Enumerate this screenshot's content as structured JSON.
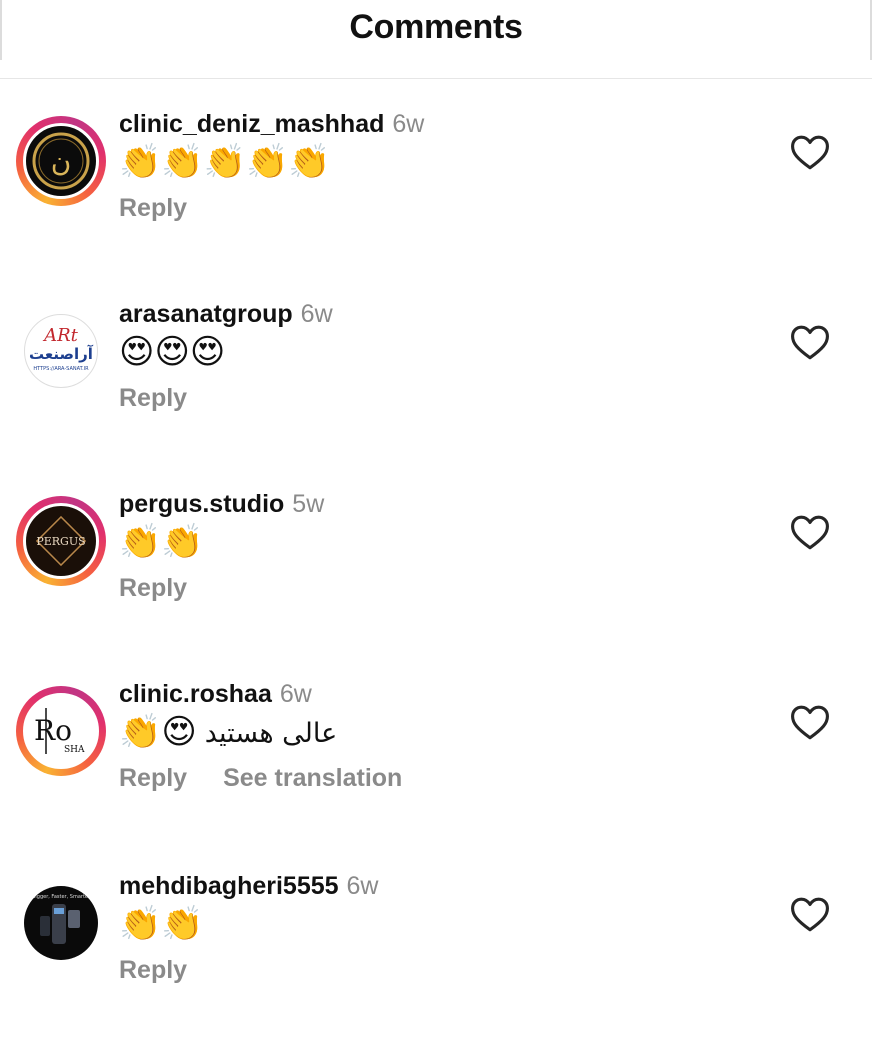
{
  "header": {
    "title": "Comments"
  },
  "comments": [
    {
      "username": "clinic_deniz_mashhad",
      "time": "6w",
      "text": "👏👏👏👏👏",
      "reply": "Reply",
      "translate": ""
    },
    {
      "username": "arasanatgroup",
      "time": "6w",
      "text": "😍😍😍",
      "reply": "Reply",
      "translate": ""
    },
    {
      "username": "pergus.studio",
      "time": "5w",
      "text": "👏👏",
      "reply": "Reply",
      "translate": ""
    },
    {
      "username": "clinic.roshaa",
      "time": "6w",
      "text": "👏😍",
      "text_fa": "عالی هستید",
      "reply": "Reply",
      "translate": "See translation"
    },
    {
      "username": "mehdibagheri5555",
      "time": "6w",
      "text": "👏👏",
      "reply": "Reply",
      "translate": ""
    }
  ],
  "avatars": {
    "a1": "ن",
    "a2_top": "ARt",
    "a2_mid": "آراصنعت",
    "a2_url": "HTTPS://ARA-SANAT.IR",
    "a3": "PERGUS",
    "a4_big": "Ro",
    "a4_small": "SHA",
    "a5": "Bigger, Faster, Smarter"
  },
  "icons": {
    "like": "heart-outline-icon"
  },
  "colors": {
    "story_ring": "#e1306c",
    "muted": "#8a8a8a"
  }
}
